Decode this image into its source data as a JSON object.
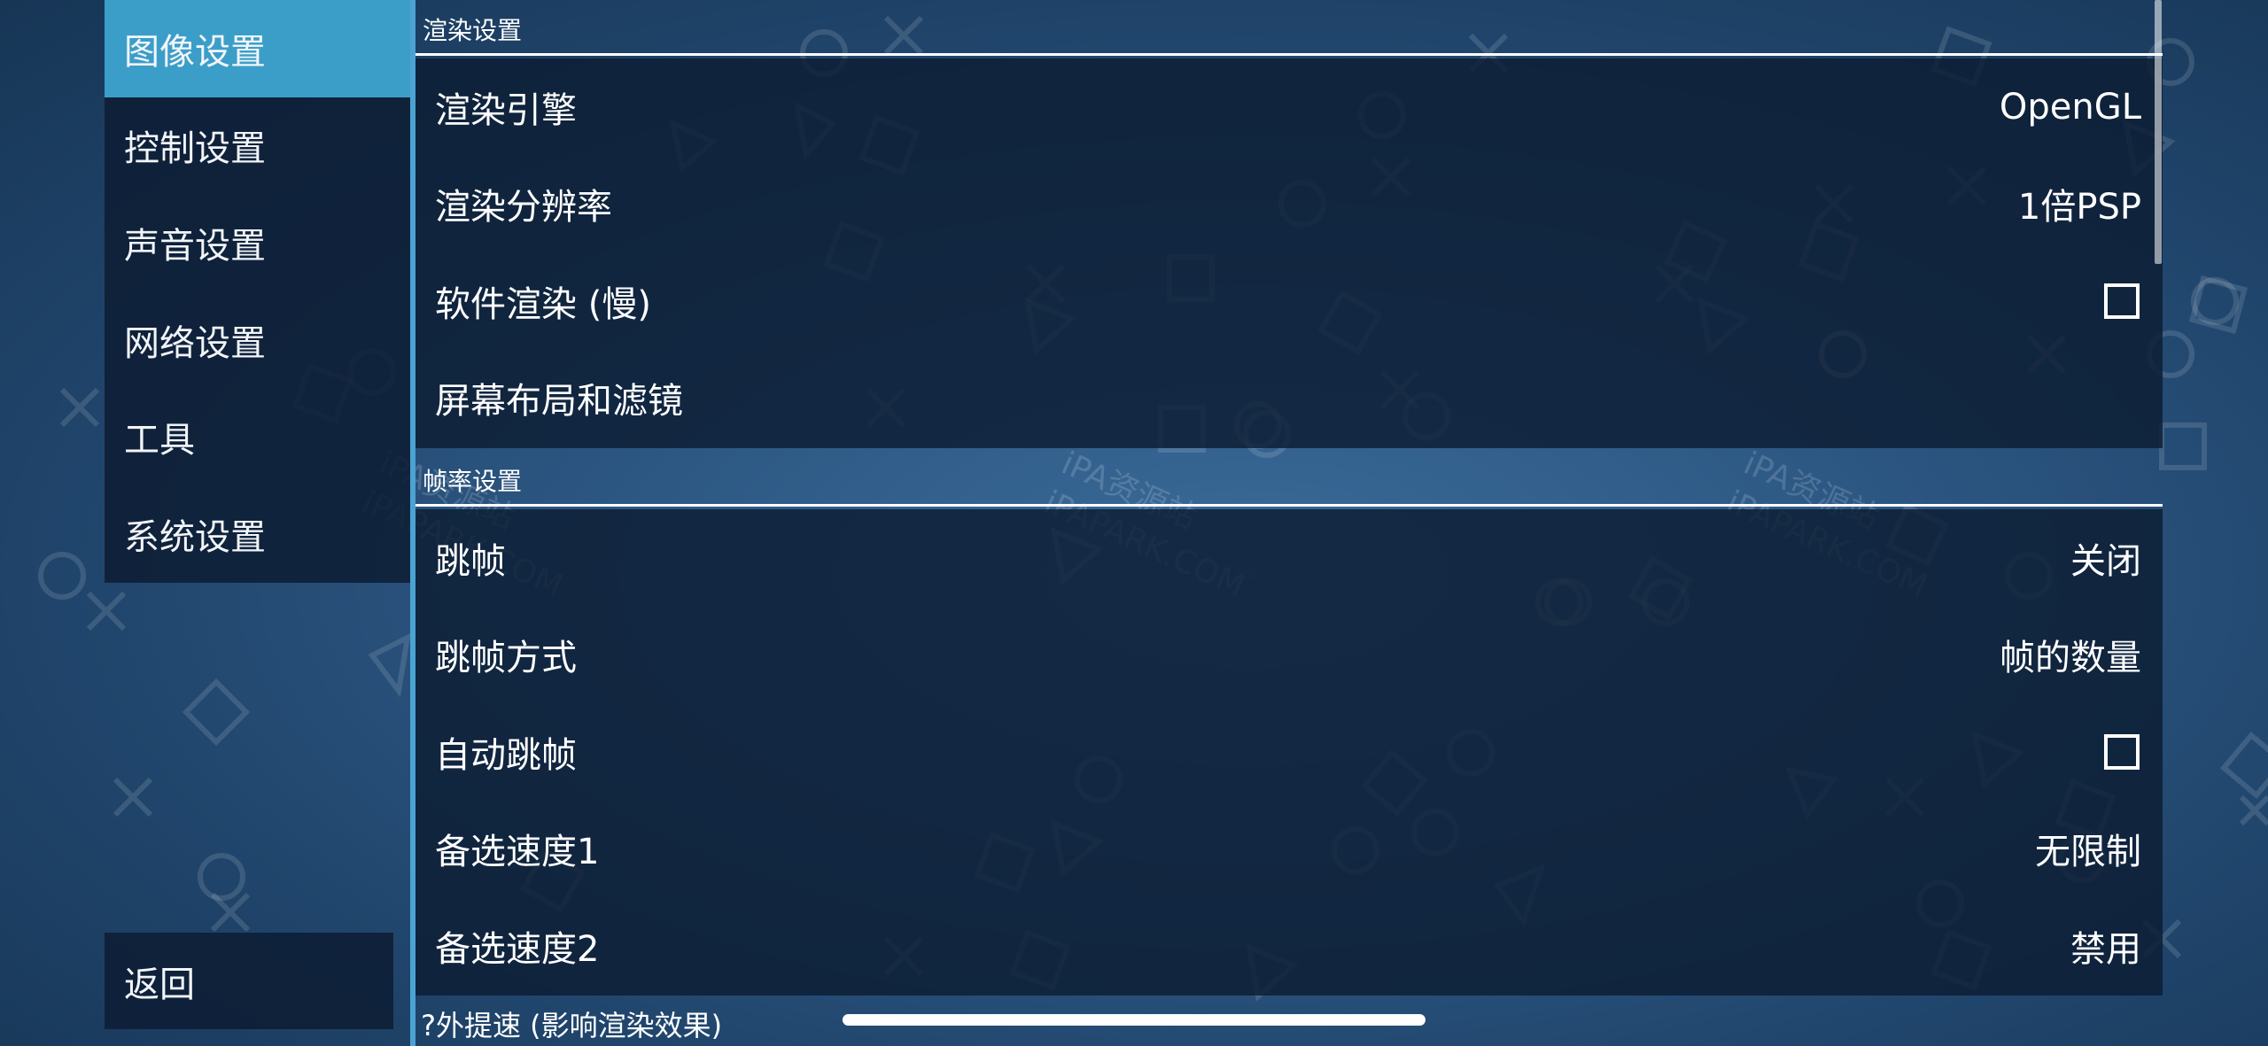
{
  "sidebar": {
    "items": [
      {
        "label": "图像设置",
        "active": true
      },
      {
        "label": "控制设置",
        "active": false
      },
      {
        "label": "声音设置",
        "active": false
      },
      {
        "label": "网络设置",
        "active": false
      },
      {
        "label": "工具",
        "active": false
      },
      {
        "label": "系统设置",
        "active": false
      }
    ],
    "back_label": "返回"
  },
  "sections": [
    {
      "title": "渲染设置",
      "rows": [
        {
          "label": "渲染引擎",
          "value": "OpenGL"
        },
        {
          "label": "渲染分辨率",
          "value": "1倍PSP"
        },
        {
          "label": "软件渲染 (慢)",
          "checked": false
        },
        {
          "label": "屏幕布局和滤镜",
          "value": ""
        }
      ]
    },
    {
      "title": "帧率设置",
      "rows": [
        {
          "label": "跳帧",
          "value": "关闭"
        },
        {
          "label": "跳帧方式",
          "value": "帧的数量"
        },
        {
          "label": "自动跳帧",
          "checked": false
        },
        {
          "label": "备选速度1",
          "value": "无限制"
        },
        {
          "label": "备选速度2",
          "value": "禁用"
        }
      ]
    }
  ],
  "footer_label": "?外提速 (影响渲染效果)",
  "watermark": {
    "line1": "iPA资源站",
    "line2": "iPAPARK.COM"
  },
  "colors": {
    "accent": "#3b9ec9",
    "panel": "#0e1e34",
    "background": "#2d5884"
  },
  "icons": {
    "checkbox": "checkbox-unchecked-icon"
  }
}
